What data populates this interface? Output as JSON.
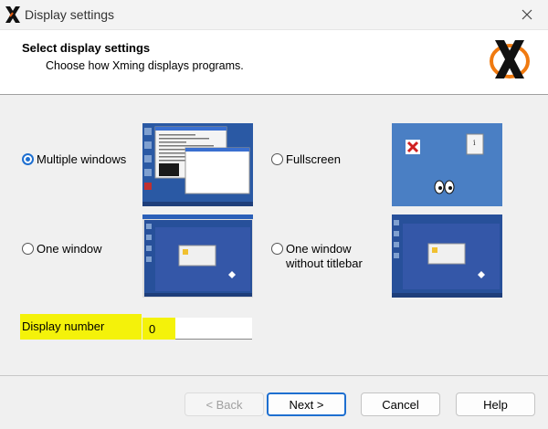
{
  "window": {
    "title": "Display settings"
  },
  "header": {
    "title": "Select display settings",
    "subtitle": "Choose how Xming displays programs."
  },
  "options": [
    {
      "label": "Multiple windows",
      "selected": true
    },
    {
      "label": "Fullscreen",
      "selected": false
    },
    {
      "label": "One window",
      "selected": false
    },
    {
      "label_line1": "One window",
      "label_line2": "without titlebar",
      "selected": false
    }
  ],
  "display_number": {
    "label": "Display number",
    "value": "0"
  },
  "buttons": {
    "back": "< Back",
    "next": "Next >",
    "cancel": "Cancel",
    "help": "Help"
  },
  "colors": {
    "accent": "#1e6fd0",
    "highlight": "#f4f20a",
    "desktop_blue": "#2a59a4"
  },
  "icons": [
    "xming-x-icon",
    "close-icon",
    "xming-logo"
  ]
}
